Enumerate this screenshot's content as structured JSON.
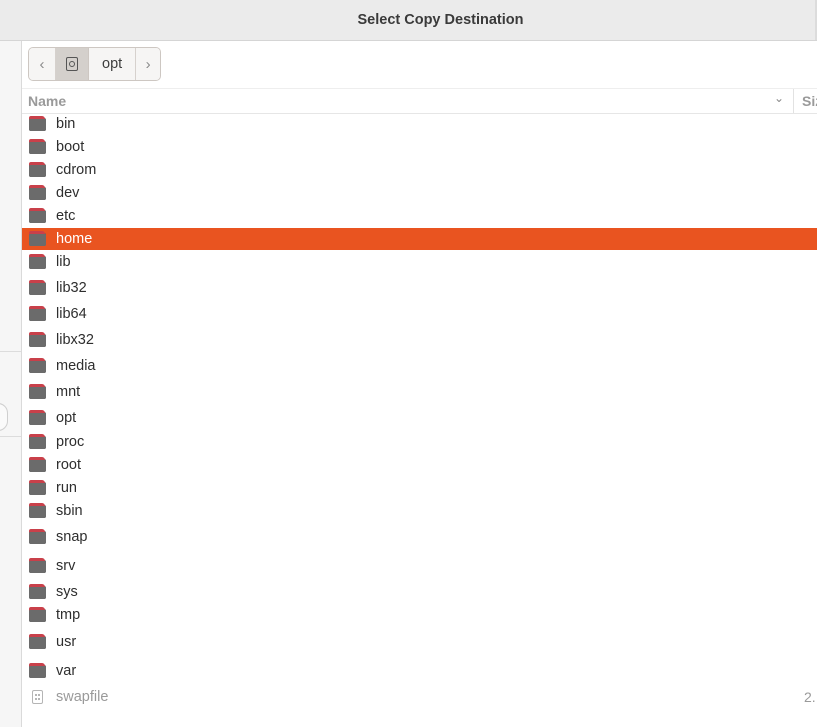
{
  "window": {
    "title": "Select Copy Destination"
  },
  "pathbar": {
    "prev_icon": "chevron-left-icon",
    "root_icon": "drive-icon",
    "crumb": "opt",
    "next_icon": "chevron-right-icon"
  },
  "columns": {
    "name": "Name",
    "size": "Siz",
    "sort_icon": "chevron-down-icon"
  },
  "selection_color": "#e95420",
  "items": [
    {
      "name": "bin",
      "kind": "folder"
    },
    {
      "name": "boot",
      "kind": "folder"
    },
    {
      "name": "cdrom",
      "kind": "folder"
    },
    {
      "name": "dev",
      "kind": "folder"
    },
    {
      "name": "etc",
      "kind": "folder"
    },
    {
      "name": "home",
      "kind": "folder",
      "selected": true
    },
    {
      "name": "lib",
      "kind": "folder"
    },
    {
      "name": "lib32",
      "kind": "folder"
    },
    {
      "name": "lib64",
      "kind": "folder"
    },
    {
      "name": "libx32",
      "kind": "folder"
    },
    {
      "name": "media",
      "kind": "folder"
    },
    {
      "name": "mnt",
      "kind": "folder"
    },
    {
      "name": "opt",
      "kind": "folder"
    },
    {
      "name": "proc",
      "kind": "folder"
    },
    {
      "name": "root",
      "kind": "folder"
    },
    {
      "name": "run",
      "kind": "folder"
    },
    {
      "name": "sbin",
      "kind": "folder"
    },
    {
      "name": "snap",
      "kind": "folder"
    },
    {
      "name": "srv",
      "kind": "folder"
    },
    {
      "name": "sys",
      "kind": "folder"
    },
    {
      "name": "tmp",
      "kind": "folder"
    },
    {
      "name": "usr",
      "kind": "folder"
    },
    {
      "name": "var",
      "kind": "folder"
    },
    {
      "name": "swapfile",
      "kind": "file",
      "size": "2."
    }
  ]
}
